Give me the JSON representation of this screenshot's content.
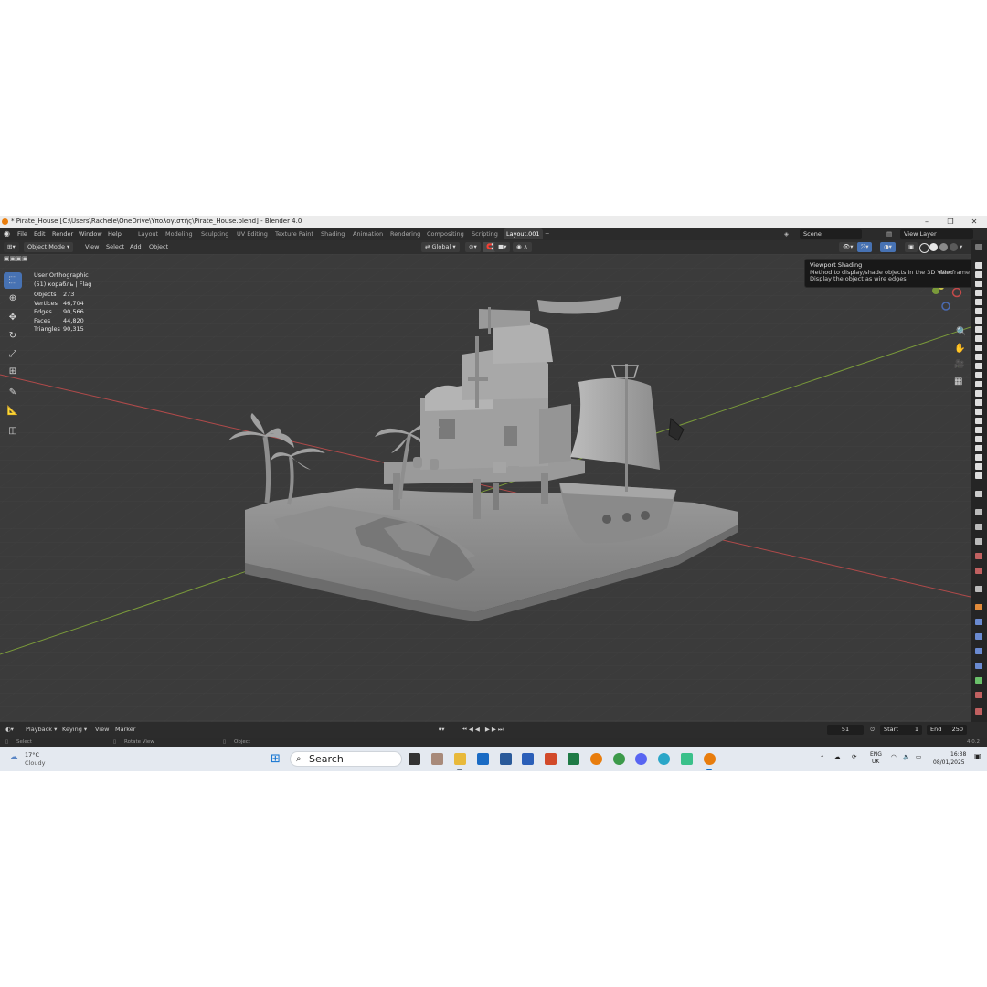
{
  "window": {
    "title": "* Pirate_House [C:\\Users\\Rachele\\OneDrive\\Υπολογιστής\\Pirate_House.blend] - Blender 4.0",
    "controls": [
      "–",
      "❐",
      "✕"
    ]
  },
  "menu": [
    "File",
    "Edit",
    "Render",
    "Window",
    "Help"
  ],
  "workspaces": [
    "Layout",
    "Modeling",
    "Sculpting",
    "UV Editing",
    "Texture Paint",
    "Shading",
    "Animation",
    "Rendering",
    "Compositing",
    "Scripting",
    "Layout.001"
  ],
  "active_workspace": "Layout.001",
  "scene": "Scene",
  "view_layer": "View Layer",
  "viewport_header": {
    "mode": "Object Mode",
    "menus": [
      "View",
      "Select",
      "Add",
      "Object"
    ],
    "transform": "Global"
  },
  "viewport": {
    "view_name": "User Orthographic",
    "object_name": "(51) корабль | Flag",
    "stats": [
      {
        "label": "Objects",
        "value": "273"
      },
      {
        "label": "Vertices",
        "value": "46,704"
      },
      {
        "label": "Edges",
        "value": "90,566"
      },
      {
        "label": "Faces",
        "value": "44,820"
      },
      {
        "label": "Triangles",
        "value": "90,315"
      }
    ]
  },
  "tooltip": {
    "title": "Viewport Shading",
    "line1": "Method to display/shade objects in the 3D View:",
    "value": "Wireframe",
    "line2": "Display the object as wire edges"
  },
  "timeline": {
    "menus": [
      "Playback",
      "Keying",
      "View",
      "Marker"
    ],
    "current_frame": "51",
    "start_label": "Start",
    "start": "1",
    "end_label": "End",
    "end": "250"
  },
  "statusbar": {
    "select": "Select",
    "rotate": "Rotate View",
    "object": "Object",
    "version": "4.0.2"
  },
  "taskbar": {
    "weather_temp": "17°C",
    "weather_desc": "Cloudy",
    "search_placeholder": "Search",
    "lang1": "ENG",
    "lang2": "UK",
    "time": "16:38",
    "date": "08/01/2025"
  },
  "colors": {
    "accent": "#4772b3",
    "axis_x": "#b04a4a",
    "axis_y": "#7a9a3a",
    "blender_orange": "#e87d0d"
  }
}
